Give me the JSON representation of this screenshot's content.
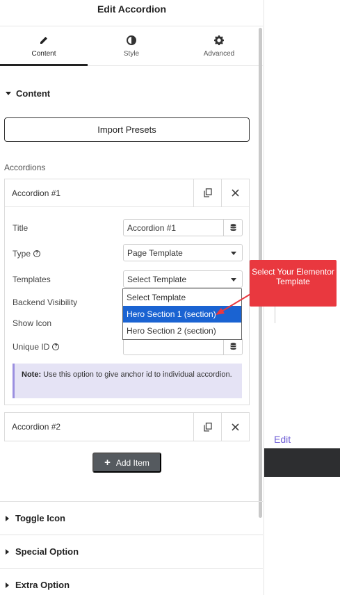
{
  "header": {
    "title": "Edit Accordion"
  },
  "tabs": [
    {
      "label": "Content",
      "icon": "pencil-icon",
      "active": true
    },
    {
      "label": "Style",
      "icon": "half-circle-icon",
      "active": false
    },
    {
      "label": "Advanced",
      "icon": "gear-icon",
      "active": false
    }
  ],
  "content_section": {
    "title": "Content"
  },
  "import_presets": {
    "label": "Import Presets"
  },
  "accordions_label": "Accordions",
  "accordion1": {
    "title": "Accordion #1",
    "fields": {
      "title_label": "Title",
      "title_value": "Accordion #1",
      "type_label": "Type",
      "type_value": "Page Template",
      "templates_label": "Templates",
      "templates_value": "Select Template",
      "backend_visibility_label": "Backend Visibility",
      "show_icon_label": "Show Icon",
      "unique_id_label": "Unique ID"
    },
    "note": {
      "bold": "Note:",
      "text": " Use this option to give anchor id to individual accordion."
    }
  },
  "templates_dropdown": {
    "options": [
      "Select Template",
      "Hero Section 1 (section)",
      "Hero Section 2 (section)"
    ],
    "selected_index": 1
  },
  "accordion2": {
    "title": "Accordion #2"
  },
  "add_item": {
    "label": "Add Item"
  },
  "collapsed_sections": [
    "Toggle Icon",
    "Special Option",
    "Extra Option"
  ],
  "callout": {
    "text": "Select Your Elementor Template",
    "color": "#e9383f"
  },
  "preview": {
    "edit_label": "Edit"
  },
  "colors": {
    "accent": "#1a63d2",
    "note_bg": "#e5e3f5",
    "note_border": "#9b8fe0",
    "button_dark": "#555a5f"
  }
}
